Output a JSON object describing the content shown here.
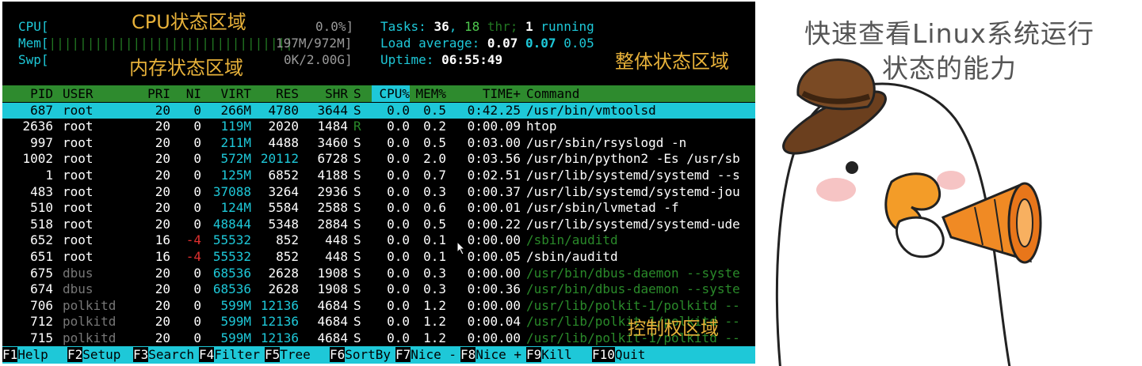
{
  "meters": {
    "cpu": {
      "label": "CPU[",
      "value": "0.0%]"
    },
    "mem": {
      "label": "Mem[",
      "value": "197M/972M]"
    },
    "swp": {
      "label": "Swp[",
      "value": "0K/2.00G]"
    }
  },
  "stats": {
    "tasks_label": "Tasks: ",
    "tasks": "36",
    "tasks_sep": ", ",
    "thr": "18",
    "thr_label": " thr; ",
    "running": "1",
    "running_label": " running",
    "load_label": "Load average: ",
    "load1": "0.07",
    "load5": "0.07",
    "load15": "0.05",
    "uptime_label": "Uptime: ",
    "uptime": "06:55:49"
  },
  "annotations": {
    "cpu_area": "CPU状态区域",
    "mem_area": "内存状态区域",
    "overall_area": "整体状态区域",
    "control_area": "控制权区域"
  },
  "header": [
    "PID",
    "USER",
    "PRI",
    "NI",
    "VIRT",
    "RES",
    "SHR",
    "S",
    "CPU%",
    "MEM%",
    "TIME+",
    "Command"
  ],
  "processes": [
    {
      "pid": "687",
      "user": "root",
      "pri": "20",
      "ni": "0",
      "virt": "266M",
      "res": "4780",
      "shr": "3644",
      "s": "S",
      "cpu": "0.0",
      "mem": "0.5",
      "time": "0:42.25",
      "cmd": "/usr/bin/vmtoolsd"
    },
    {
      "pid": "2636",
      "user": "root",
      "pri": "20",
      "ni": "0",
      "virt": "119M",
      "res": "2020",
      "shr": "1484",
      "s": "R",
      "cpu": "0.0",
      "mem": "0.2",
      "time": "0:00.09",
      "cmd": "htop"
    },
    {
      "pid": "997",
      "user": "root",
      "pri": "20",
      "ni": "0",
      "virt": "211M",
      "res": "4488",
      "shr": "3460",
      "s": "S",
      "cpu": "0.0",
      "mem": "0.5",
      "time": "0:03.00",
      "cmd": "/usr/sbin/rsyslogd -n"
    },
    {
      "pid": "1002",
      "user": "root",
      "pri": "20",
      "ni": "0",
      "virt": "572M",
      "res": "20112",
      "shr": "6728",
      "s": "S",
      "cpu": "0.0",
      "mem": "2.0",
      "time": "0:03.56",
      "cmd": "/usr/bin/python2 -Es /usr/sb"
    },
    {
      "pid": "1",
      "user": "root",
      "pri": "20",
      "ni": "0",
      "virt": "125M",
      "res": "6852",
      "shr": "4188",
      "s": "S",
      "cpu": "0.0",
      "mem": "0.7",
      "time": "0:02.51",
      "cmd": "/usr/lib/systemd/systemd --s"
    },
    {
      "pid": "483",
      "user": "root",
      "pri": "20",
      "ni": "0",
      "virt": "37088",
      "res": "3264",
      "shr": "2936",
      "s": "S",
      "cpu": "0.0",
      "mem": "0.3",
      "time": "0:00.37",
      "cmd": "/usr/lib/systemd/systemd-jou"
    },
    {
      "pid": "510",
      "user": "root",
      "pri": "20",
      "ni": "0",
      "virt": "124M",
      "res": "5584",
      "shr": "2588",
      "s": "S",
      "cpu": "0.0",
      "mem": "0.6",
      "time": "0:00.01",
      "cmd": "/usr/sbin/lvmetad -f"
    },
    {
      "pid": "518",
      "user": "root",
      "pri": "20",
      "ni": "0",
      "virt": "48844",
      "res": "5348",
      "shr": "2884",
      "s": "S",
      "cpu": "0.0",
      "mem": "0.5",
      "time": "0:00.22",
      "cmd": "/usr/lib/systemd/systemd-ude"
    },
    {
      "pid": "652",
      "user": "root",
      "pri": "16",
      "ni": "-4",
      "virt": "55532",
      "res": "852",
      "shr": "448",
      "s": "S",
      "cpu": "0.0",
      "mem": "0.1",
      "time": "0:00.00",
      "cmd": "/sbin/auditd"
    },
    {
      "pid": "651",
      "user": "root",
      "pri": "16",
      "ni": "-4",
      "virt": "55532",
      "res": "852",
      "shr": "448",
      "s": "S",
      "cpu": "0.0",
      "mem": "0.1",
      "time": "0:00.05",
      "cmd": "/sbin/auditd"
    },
    {
      "pid": "675",
      "user": "dbus",
      "pri": "20",
      "ni": "0",
      "virt": "68536",
      "res": "2628",
      "shr": "1908",
      "s": "S",
      "cpu": "0.0",
      "mem": "0.3",
      "time": "0:00.00",
      "cmd": "/usr/bin/dbus-daemon --syste"
    },
    {
      "pid": "674",
      "user": "dbus",
      "pri": "20",
      "ni": "0",
      "virt": "68536",
      "res": "2628",
      "shr": "1908",
      "s": "S",
      "cpu": "0.0",
      "mem": "0.3",
      "time": "0:00.36",
      "cmd": "/usr/bin/dbus-daemon --syste"
    },
    {
      "pid": "706",
      "user": "polkitd",
      "pri": "20",
      "ni": "0",
      "virt": "599M",
      "res": "12136",
      "shr": "4684",
      "s": "S",
      "cpu": "0.0",
      "mem": "1.2",
      "time": "0:00.00",
      "cmd": "/usr/lib/polkit-1/polkitd --"
    },
    {
      "pid": "712",
      "user": "polkitd",
      "pri": "20",
      "ni": "0",
      "virt": "599M",
      "res": "12136",
      "shr": "4684",
      "s": "S",
      "cpu": "0.0",
      "mem": "1.2",
      "time": "0:00.04",
      "cmd": "/usr/lib/polkit-1/polkitd --"
    },
    {
      "pid": "715",
      "user": "polkitd",
      "pri": "20",
      "ni": "0",
      "virt": "599M",
      "res": "12136",
      "shr": "4684",
      "s": "S",
      "cpu": "0.0",
      "mem": "1.2",
      "time": "0:00.00",
      "cmd": "/usr/lib/polkit-1/polkitd --"
    }
  ],
  "fkeys": [
    {
      "key": "F1",
      "label": "Help"
    },
    {
      "key": "F2",
      "label": "Setup"
    },
    {
      "key": "F3",
      "label": "Search"
    },
    {
      "key": "F4",
      "label": "Filter"
    },
    {
      "key": "F5",
      "label": "Tree"
    },
    {
      "key": "F6",
      "label": "SortBy"
    },
    {
      "key": "F7",
      "label": "Nice -"
    },
    {
      "key": "F8",
      "label": "Nice +"
    },
    {
      "key": "F9",
      "label": "Kill"
    },
    {
      "key": "F10",
      "label": "Quit"
    }
  ],
  "caption": {
    "line1": "快速查看Linux系统运行",
    "line2": "状态的能力"
  },
  "colors": {
    "terminal_bg": "#000000",
    "header_bg": "#2e8b2e",
    "selected_bg": "#1ec8d8",
    "annotation": "#e8b23a"
  }
}
